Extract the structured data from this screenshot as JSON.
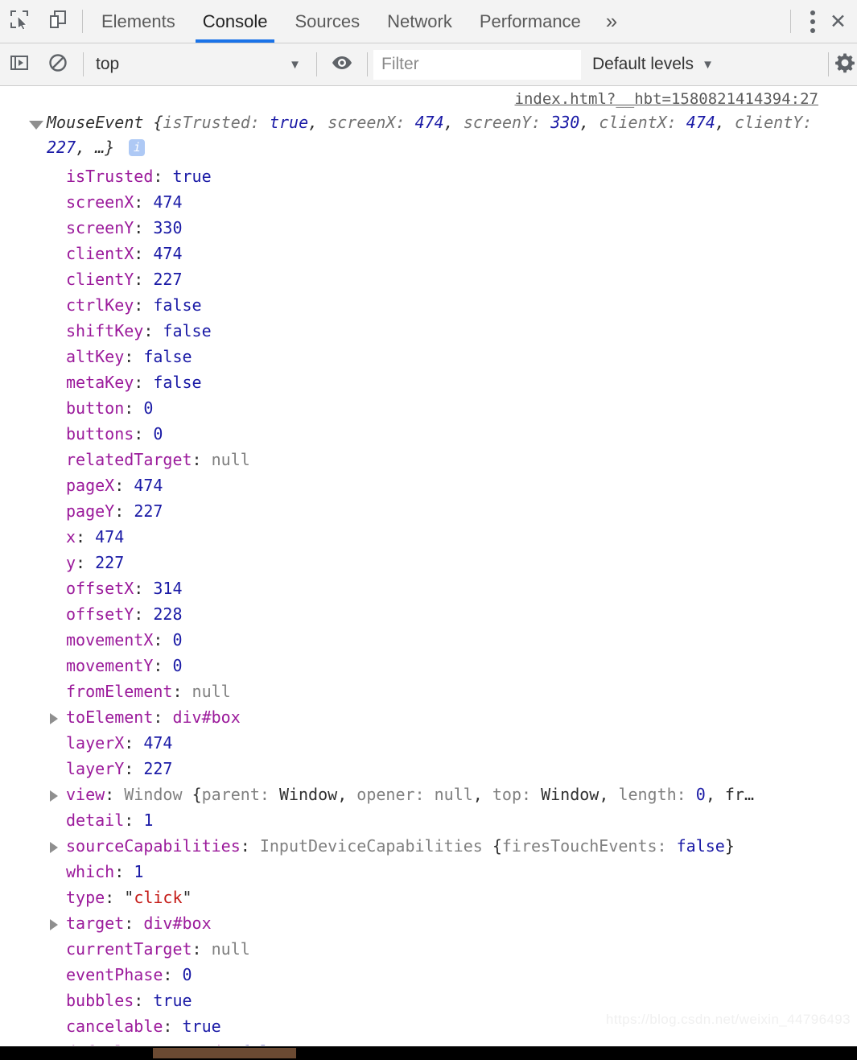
{
  "devtools": {
    "tabs": [
      {
        "label": "Elements",
        "active": false
      },
      {
        "label": "Console",
        "active": true
      },
      {
        "label": "Sources",
        "active": false
      },
      {
        "label": "Network",
        "active": false
      },
      {
        "label": "Performance",
        "active": false
      }
    ],
    "more_tabs_glyph": "»",
    "inspect_icon": "inspect-element-icon",
    "device_icon": "device-toolbar-icon",
    "menu_icon": "more-options-icon",
    "close_icon": "✕",
    "accent_color": "#1a73e8"
  },
  "console_toolbar": {
    "sidebar_toggle_icon": "console-sidebar-icon",
    "clear_icon": "clear-console-icon",
    "context": "top",
    "context_caret": "▼",
    "live_expression_icon": "eye-icon",
    "filter_placeholder": "Filter",
    "filter_value": "",
    "levels_label": "Default levels",
    "levels_caret": "▼",
    "settings_icon": "gear-icon"
  },
  "console_message": {
    "source_link": "index.html?__hbt=1580821414394:27",
    "expand_arrow": "expanded",
    "preview_line1_class": "MouseEvent ",
    "preview_line1_open": "{",
    "preview_line1_parts": [
      {
        "key": "isTrusted",
        "val": "true",
        "type": "bool"
      },
      {
        "key": "screenX",
        "val": "474",
        "type": "num"
      },
      {
        "key": "screenY",
        "val": "330",
        "type": "num"
      },
      {
        "key": "clientX",
        "val": "474",
        "type": "num"
      },
      {
        "key": "clientY",
        "val": "227",
        "type": "num"
      }
    ],
    "preview_tail": ", …}",
    "info_badge": "i",
    "properties": [
      {
        "name": "isTrusted",
        "value": "true",
        "type": "bool",
        "expandable": false
      },
      {
        "name": "screenX",
        "value": "474",
        "type": "num",
        "expandable": false
      },
      {
        "name": "screenY",
        "value": "330",
        "type": "num",
        "expandable": false
      },
      {
        "name": "clientX",
        "value": "474",
        "type": "num",
        "expandable": false
      },
      {
        "name": "clientY",
        "value": "227",
        "type": "num",
        "expandable": false
      },
      {
        "name": "ctrlKey",
        "value": "false",
        "type": "bool",
        "expandable": false
      },
      {
        "name": "shiftKey",
        "value": "false",
        "type": "bool",
        "expandable": false
      },
      {
        "name": "altKey",
        "value": "false",
        "type": "bool",
        "expandable": false
      },
      {
        "name": "metaKey",
        "value": "false",
        "type": "bool",
        "expandable": false
      },
      {
        "name": "button",
        "value": "0",
        "type": "num",
        "expandable": false
      },
      {
        "name": "buttons",
        "value": "0",
        "type": "num",
        "expandable": false
      },
      {
        "name": "relatedTarget",
        "value": "null",
        "type": "null",
        "expandable": false
      },
      {
        "name": "pageX",
        "value": "474",
        "type": "num",
        "expandable": false
      },
      {
        "name": "pageY",
        "value": "227",
        "type": "num",
        "expandable": false
      },
      {
        "name": "x",
        "value": "474",
        "type": "num",
        "expandable": false
      },
      {
        "name": "y",
        "value": "227",
        "type": "num",
        "expandable": false
      },
      {
        "name": "offsetX",
        "value": "314",
        "type": "num",
        "expandable": false
      },
      {
        "name": "offsetY",
        "value": "228",
        "type": "num",
        "expandable": false
      },
      {
        "name": "movementX",
        "value": "0",
        "type": "num",
        "expandable": false
      },
      {
        "name": "movementY",
        "value": "0",
        "type": "num",
        "expandable": false
      },
      {
        "name": "fromElement",
        "value": "null",
        "type": "null",
        "expandable": false
      },
      {
        "name": "toElement",
        "value": "div#box",
        "type": "node",
        "expandable": true
      },
      {
        "name": "layerX",
        "value": "474",
        "type": "num",
        "expandable": false
      },
      {
        "name": "layerY",
        "value": "227",
        "type": "num",
        "expandable": false
      },
      {
        "name": "view",
        "type": "object",
        "expandable": true,
        "class_name": "Window ",
        "preview_open": "{",
        "preview_parts": [
          {
            "key": "parent",
            "val": "Window",
            "type": "plain"
          },
          {
            "key": "opener",
            "val": "null",
            "type": "null"
          },
          {
            "key": "top",
            "val": "Window",
            "type": "plain"
          },
          {
            "key": "length",
            "val": "0",
            "type": "num"
          }
        ],
        "preview_tail": ", fr…"
      },
      {
        "name": "detail",
        "value": "1",
        "type": "num",
        "expandable": false
      },
      {
        "name": "sourceCapabilities",
        "type": "object",
        "expandable": true,
        "class_name": "InputDeviceCapabilities ",
        "preview_open": "{",
        "preview_parts": [
          {
            "key": "firesTouchEvents",
            "val": "false",
            "type": "bool"
          }
        ],
        "preview_tail": "}"
      },
      {
        "name": "which",
        "value": "1",
        "type": "num",
        "expandable": false
      },
      {
        "name": "type",
        "value": "click",
        "type": "string",
        "expandable": false
      },
      {
        "name": "target",
        "value": "div#box",
        "type": "node",
        "expandable": true
      },
      {
        "name": "currentTarget",
        "value": "null",
        "type": "null",
        "expandable": false
      },
      {
        "name": "eventPhase",
        "value": "0",
        "type": "num",
        "expandable": false
      },
      {
        "name": "bubbles",
        "value": "true",
        "type": "bool",
        "expandable": false
      },
      {
        "name": "cancelable",
        "value": "true",
        "type": "bool",
        "expandable": false
      },
      {
        "name": "defaultPrevented",
        "value": "false",
        "type": "bool",
        "expandable": false
      }
    ]
  },
  "watermark": "https://blog.csdn.net/weixin_44796493"
}
